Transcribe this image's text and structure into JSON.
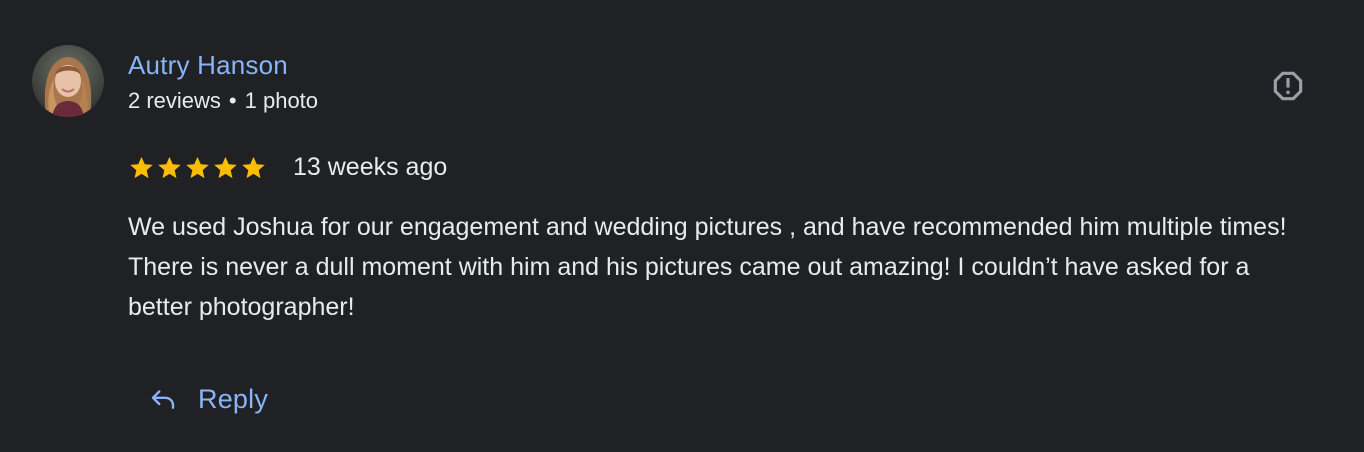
{
  "review": {
    "reviewer_name": "Autry Hanson",
    "reviewer_reviews": "2 reviews",
    "separator": "•",
    "reviewer_photos": "1 photo",
    "rating": 5,
    "rating_max": 5,
    "date": "13 weeks ago",
    "text": "We used Joshua for our engagement and wedding pictures , and have recommended him multiple times! There is never a dull moment with him and his pictures came out amazing! I couldn’t have asked for a better photographer!",
    "reply_label": "Reply"
  },
  "icons": {
    "report": "report-icon",
    "reply": "reply-icon",
    "star": "star-icon"
  },
  "colors": {
    "background": "#202124",
    "link": "#8ab4f8",
    "text": "#e8eaed",
    "star": "#fbbc04",
    "icon": "#9aa0a6"
  }
}
